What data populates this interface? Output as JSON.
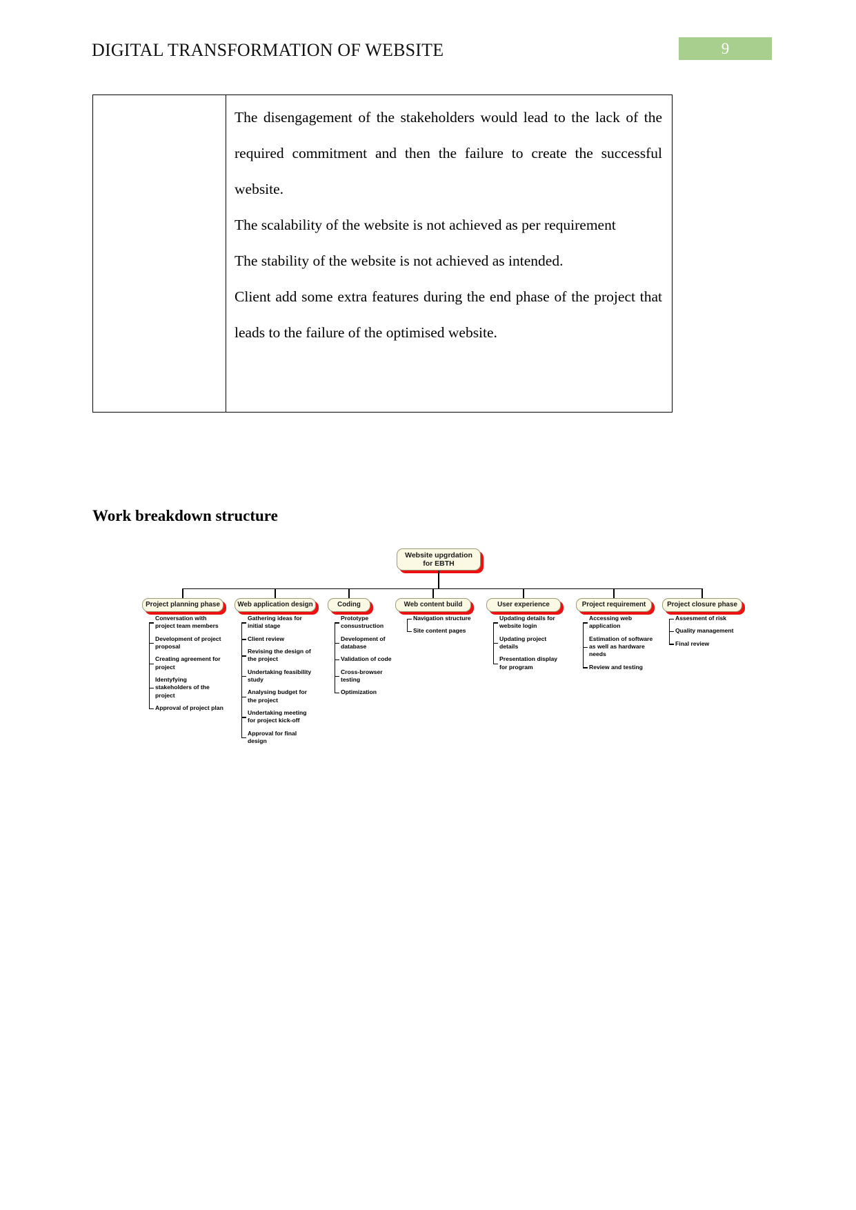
{
  "header": {
    "title": "DIGITAL TRANSFORMATION OF WEBSITE",
    "page_number": "9",
    "badge_color": "#a8cf8e"
  },
  "table": {
    "paragraphs": [
      "The disengagement of the stakeholders would lead to the lack of the required commitment and then the failure to create the successful website.",
      "The scalability of the website is not achieved as per requirement",
      "The stability of the website is not achieved as intended.",
      "Client add some extra features during the end phase of the project that leads to the failure of the optimised website."
    ]
  },
  "section": {
    "heading": "Work breakdown structure"
  },
  "wbs": {
    "root": "Website upgrdation for EBTH",
    "node_fill": "#fbf8e3",
    "node_shadow": "#ee1111",
    "phases": [
      {
        "label": "Project planning phase",
        "items": [
          "Conversation with project team members",
          "Development of project proposal",
          "Creating agreement for project",
          "Identyfying stakeholders of the project",
          "Approval of project plan"
        ]
      },
      {
        "label": "Web application design",
        "items": [
          "Gathering ideas for initial stage",
          "Client review",
          "Revising the design of the project",
          "Undertaking feasibility study",
          "Analysing budget for the project",
          "Undertaking meeting for project kick-off",
          "Approval for final design"
        ]
      },
      {
        "label": "Coding",
        "items": [
          "Prototype consustruction",
          "Development of database",
          "Validation of code",
          "Cross-browser testing",
          "Optimization"
        ]
      },
      {
        "label": "Web content build",
        "items": [
          "Navigation structure",
          "Site content pages"
        ]
      },
      {
        "label": "User experience",
        "items": [
          "Updating details for website login",
          "Updating project details",
          "Presentation display for program"
        ]
      },
      {
        "label": "Project requirement",
        "items": [
          "Accessing web application",
          "Estimation of software as well as hardware needs",
          "Review and testing"
        ]
      },
      {
        "label": "Project closure phase",
        "items": [
          "Assesment of risk",
          "Quality management",
          "Final review"
        ]
      }
    ]
  }
}
